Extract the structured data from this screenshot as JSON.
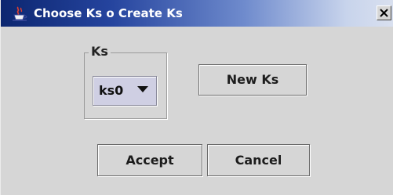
{
  "window": {
    "title": "Choose Ks o Create Ks",
    "title_icon": "java-cup-icon",
    "close_icon": "close-icon"
  },
  "ks_group": {
    "legend": "Ks",
    "combo": {
      "selected": "ks0",
      "arrow_icon": "dropdown-arrow-icon"
    }
  },
  "buttons": {
    "new_ks": "New Ks",
    "accept": "Accept",
    "cancel": "Cancel"
  },
  "colors": {
    "title_start": "#0c2670",
    "title_end": "#d9e0ef",
    "dialog_bg": "#d6d6d6",
    "combo_bg": "#cfcfe3"
  }
}
